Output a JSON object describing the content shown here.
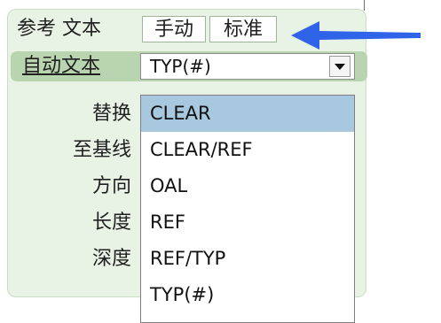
{
  "reference": {
    "label": "参考 文本",
    "manual_label": "手动",
    "standard_label": "标准"
  },
  "auto_text": {
    "label": "自动文本",
    "selected_value": "TYP(#)"
  },
  "field_labels": [
    "替换",
    "至基线",
    "方向",
    "长度",
    "深度"
  ],
  "dropdown": {
    "options": [
      "CLEAR",
      "CLEAR/REF",
      "OAL",
      "REF",
      "REF/TYP",
      "TYP(#)"
    ],
    "highlighted": "CLEAR"
  },
  "colors": {
    "panel": "#e8f3e6",
    "row_highlight": "#b8d5b0",
    "option_highlight": "#a8c8e0",
    "arrow": "#2f63e8"
  },
  "icons": {
    "dropdown_button": "triangle-down-icon",
    "pointer": "arrow-left-icon"
  }
}
